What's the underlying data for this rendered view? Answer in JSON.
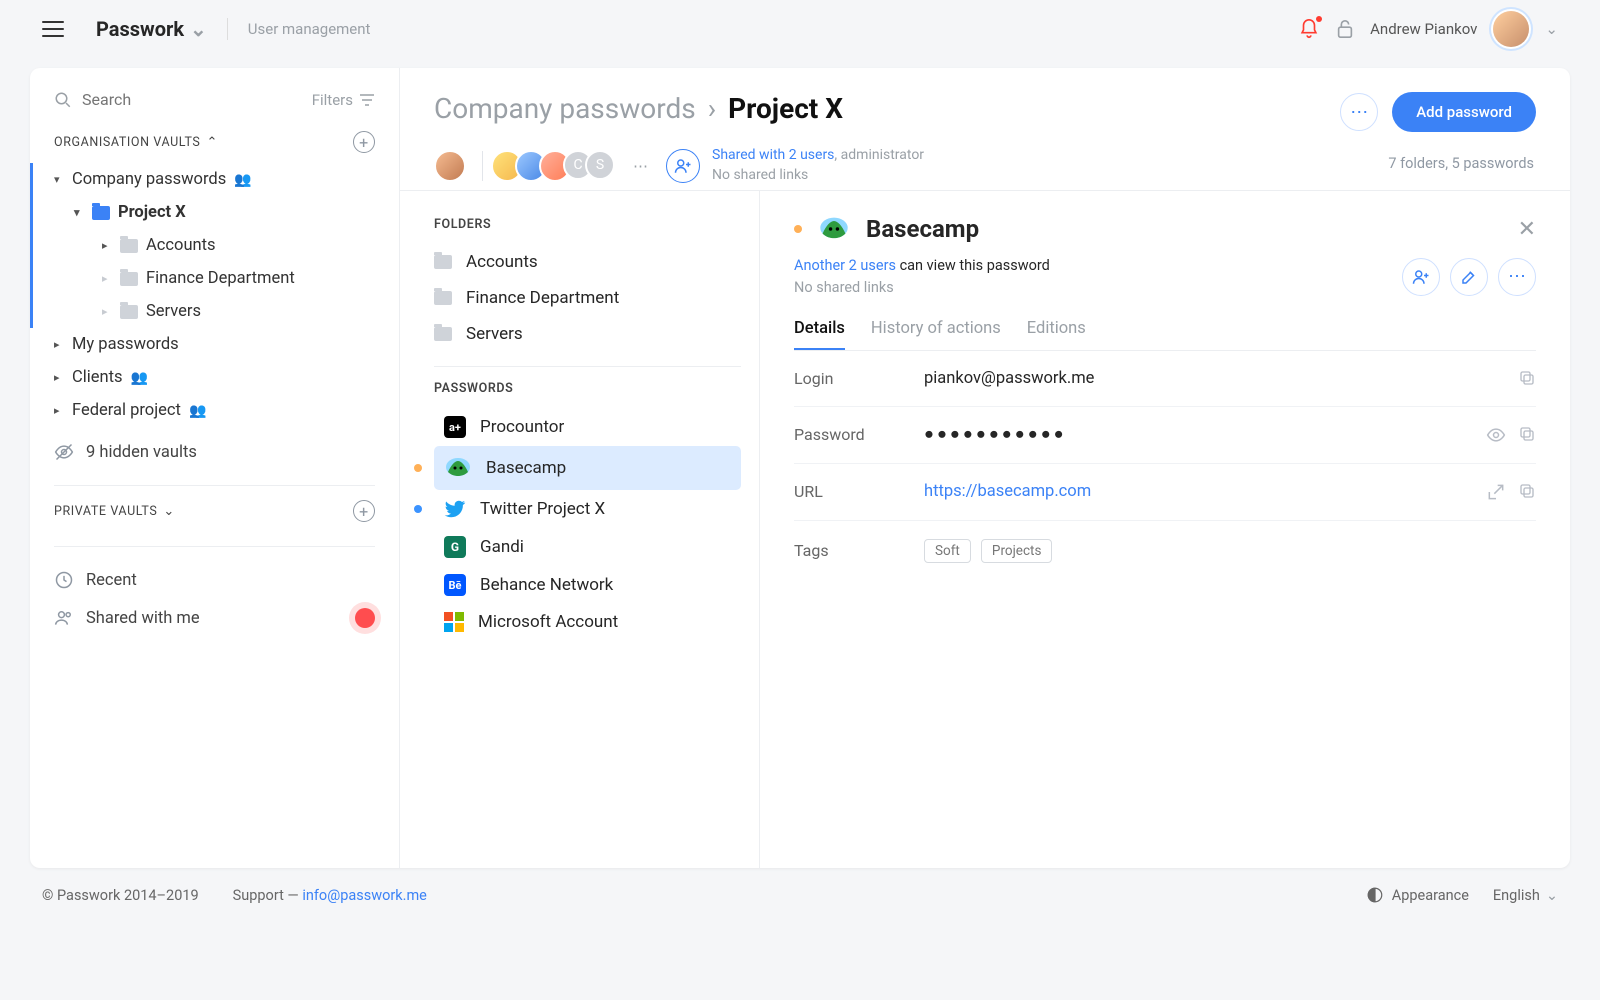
{
  "topbar": {
    "brand": "Passwork",
    "section": "User management",
    "user_name": "Andrew Piankov"
  },
  "sidebar": {
    "search_placeholder": "Search",
    "filters_label": "Filters",
    "org_heading": "Organisation vaults",
    "priv_heading": "Private vaults",
    "tree": {
      "company": "Company passwords",
      "projectx": "Project X",
      "accounts": "Accounts",
      "finance": "Finance Department",
      "servers": "Servers",
      "my": "My passwords",
      "clients": "Clients",
      "federal": "Federal project"
    },
    "hidden_vaults": "9 hidden vaults",
    "recent": "Recent",
    "shared_me": "Shared with me"
  },
  "header": {
    "crumb_root": "Company passwords",
    "crumb_current": "Project X",
    "shared_link": "Shared with 2 users",
    "shared_suffix": ", administrator",
    "no_links": "No shared links",
    "add_btn": "Add password",
    "counts": "7 folders, 5 passwords",
    "extra_badge_c": "C",
    "extra_badge_s": "S"
  },
  "mid": {
    "folders_label": "FOLDERS",
    "passwords_label": "PASSWORDS",
    "folders": {
      "accounts": "Accounts",
      "finance": "Finance Department",
      "servers": "Servers"
    },
    "pw": {
      "procountor": "Procountor",
      "basecamp": "Basecamp",
      "twitter": "Twitter Project X",
      "gandi": "Gandi",
      "behance": "Behance Network",
      "microsoft": "Microsoft Account"
    }
  },
  "detail": {
    "title": "Basecamp",
    "sub_link": "Another 2 users",
    "sub_suffix": " can view this password",
    "no_links": "No shared links",
    "tabs": {
      "details": "Details",
      "history": "History of actions",
      "editions": "Editions"
    },
    "fields": {
      "login_label": "Login",
      "login_value": "piankov@passwork.me",
      "password_label": "Password",
      "password_value": "●●●●●●●●●●●",
      "url_label": "URL",
      "url_value": "https://basecamp.com",
      "tags_label": "Tags"
    },
    "tags": {
      "soft": "Soft",
      "projects": "Projects"
    }
  },
  "footer": {
    "copyright": "© Passwork 2014–2019",
    "support_prefix": "Support — ",
    "support_email": "info@passwork.me",
    "appearance": "Appearance",
    "language": "English"
  }
}
